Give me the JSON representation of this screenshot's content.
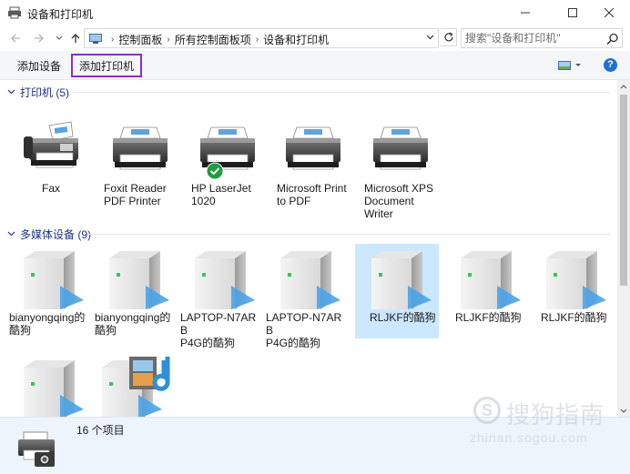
{
  "window": {
    "title": "设备和打印机"
  },
  "address": {
    "crumbs": [
      "控制面板",
      "所有控制面板项",
      "设备和打印机"
    ],
    "search_placeholder": "搜索\"设备和打印机\""
  },
  "toolbar": {
    "add_device": "添加设备",
    "add_printer": "添加打印机"
  },
  "groups": {
    "printers": {
      "title": "打印机 (5)",
      "items": [
        {
          "line1": "Fax",
          "line2": "",
          "line3": "",
          "icon": "fax-icon"
        },
        {
          "line1": "Foxit Reader",
          "line2": "PDF Printer",
          "line3": "",
          "icon": "printer-icon"
        },
        {
          "line1": "HP LaserJet",
          "line2": "1020",
          "line3": "",
          "icon": "printer-icon",
          "default": true
        },
        {
          "line1": "Microsoft Print",
          "line2": "to PDF",
          "line3": "",
          "icon": "printer-icon"
        },
        {
          "line1": "Microsoft XPS",
          "line2": "Document",
          "line3": "Writer",
          "icon": "printer-icon"
        }
      ]
    },
    "media": {
      "title": "多媒体设备 (9)",
      "items": [
        {
          "line1": "bianyongqing的",
          "line2": "酷狗",
          "icon": "media-server-icon"
        },
        {
          "line1": "bianyongqing的",
          "line2": "酷狗",
          "icon": "media-server-icon"
        },
        {
          "line1": "LAPTOP-N7ARB",
          "line2": "P4G的酷狗",
          "icon": "media-server-icon"
        },
        {
          "line1": "LAPTOP-N7ARB",
          "line2": "P4G的酷狗",
          "icon": "media-server-icon"
        },
        {
          "line1": "RLJKF的酷狗",
          "line2": "",
          "icon": "media-server-icon",
          "selected": true
        },
        {
          "line1": "RLJKF的酷狗",
          "line2": "",
          "icon": "media-server-icon"
        },
        {
          "line1": "RLJKF的酷狗",
          "line2": "",
          "icon": "media-server-icon"
        }
      ]
    }
  },
  "status": {
    "count": "16 个项目"
  },
  "watermark": {
    "text": "搜狗指南",
    "url": "zhinan.sogou.com"
  },
  "colors": {
    "accent_purple": "#8c2fc9",
    "group_header": "#1e3287",
    "selection": "#cce8ff",
    "default_check": "#1e9e3e",
    "media_play": "#4aa3e8"
  }
}
